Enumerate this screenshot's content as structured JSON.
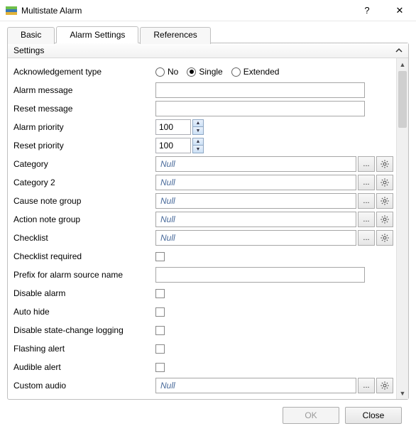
{
  "window": {
    "title": "Multistate Alarm",
    "help": "?",
    "close": "✕"
  },
  "tabs": {
    "basic": "Basic",
    "alarm_settings": "Alarm Settings",
    "references": "References"
  },
  "section": {
    "title": "Settings"
  },
  "labels": {
    "ack_type": "Acknowledgement type",
    "alarm_message": "Alarm message",
    "reset_message": "Reset message",
    "alarm_priority": "Alarm priority",
    "reset_priority": "Reset priority",
    "category": "Category",
    "category2": "Category 2",
    "cause_note_group": "Cause note group",
    "action_note_group": "Action note group",
    "checklist": "Checklist",
    "checklist_required": "Checklist required",
    "prefix": "Prefix for alarm source name",
    "disable_alarm": "Disable alarm",
    "auto_hide": "Auto hide",
    "disable_state_logging": "Disable state-change logging",
    "flashing_alert": "Flashing alert",
    "audible_alert": "Audible alert",
    "custom_audio": "Custom audio"
  },
  "radios": {
    "no": "No",
    "single": "Single",
    "extended": "Extended"
  },
  "values": {
    "alarm_message": "",
    "reset_message": "",
    "alarm_priority": "100",
    "reset_priority": "100",
    "null_text": "Null",
    "ellipsis": "...",
    "prefix": ""
  },
  "footer": {
    "ok": "OK",
    "close": "Close"
  }
}
